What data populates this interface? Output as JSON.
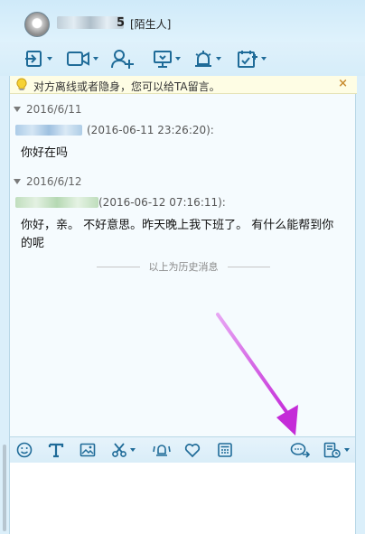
{
  "header": {
    "contact_name_tail": "5",
    "contact_tag": "[陌生人]"
  },
  "toolbar": {
    "buttons": [
      "send-file",
      "video-call",
      "add-friend",
      "remote-desktop",
      "alarm",
      "schedule"
    ]
  },
  "notice": {
    "text": "对方离线或者隐身，您可以给TA留言。",
    "close": "×"
  },
  "history": {
    "groups": [
      {
        "date": "2016/6/11",
        "time": "(2016-06-11 23:26:20):",
        "message": "你好在吗"
      },
      {
        "date": "2016/6/12",
        "time": "(2016-06-12 07:16:11):",
        "message_line1": "你好，亲。 不好意思。昨天晚上我下班了。 有什么能帮到你",
        "message_line2": "的呢"
      }
    ],
    "divider_text": "以上为历史消息"
  },
  "input_toolbar": {
    "buttons": [
      "emoji",
      "font",
      "screenshot-image",
      "scissors",
      "shake",
      "heart",
      "calculator",
      "message-forward",
      "message-record"
    ]
  },
  "colors": {
    "accent": "#1f6b98",
    "arrow": "#c42bd8",
    "notice_bg": "#fefde4"
  }
}
